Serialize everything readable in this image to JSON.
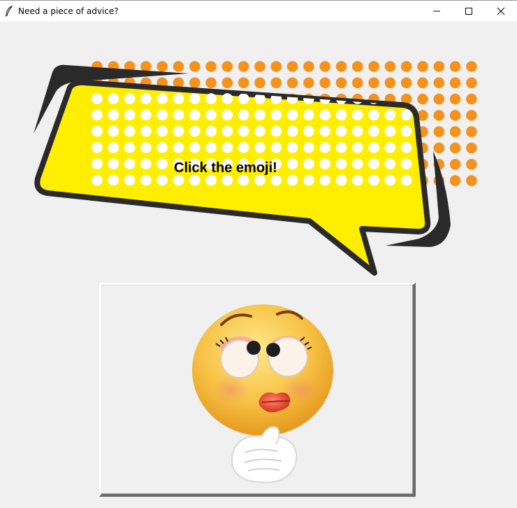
{
  "window": {
    "title": "Need a piece of advice?",
    "controls": {
      "minimize": "minimize",
      "maximize": "maximize",
      "close": "close"
    }
  },
  "bubble": {
    "text": "Click the emoji!",
    "fill_color": "#ffee00",
    "outline_color": "#2a2a2a",
    "dot_color_front": "#ffffff",
    "dot_color_back": "#f5921e"
  },
  "emoji": {
    "icon": "thinking-girl-emoji-icon",
    "face_color": "#f7c245",
    "lips_color": "#e8402b"
  },
  "colors": {
    "window_bg": "#f0f0f0",
    "titlebar_bg": "#ffffff"
  }
}
